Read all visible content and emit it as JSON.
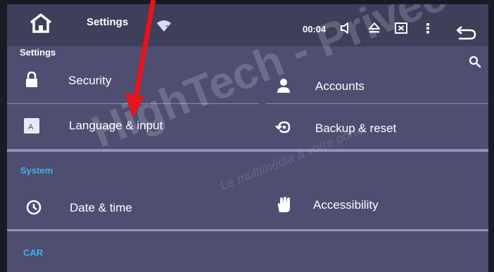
{
  "statusbar": {
    "title": "Settings",
    "time": "00:04",
    "icons": [
      "home-icon",
      "wifi-icon",
      "volume-icon",
      "eject-icon",
      "close-box-icon",
      "more-vert-icon",
      "back-icon"
    ]
  },
  "header": {
    "label": "Settings",
    "search_icon": "search-icon"
  },
  "personal": {
    "items": [
      {
        "label": "Security",
        "icon": "lock-icon"
      },
      {
        "label": "Accounts",
        "icon": "person-icon"
      },
      {
        "label": "Language & input",
        "icon": "keyboard-a-icon"
      },
      {
        "label": "Backup & reset",
        "icon": "backup-icon"
      }
    ]
  },
  "system": {
    "title": "System",
    "items": [
      {
        "label": "Date & time",
        "icon": "clock-icon"
      },
      {
        "label": "Accessibility",
        "icon": "hand-icon"
      }
    ]
  },
  "car": {
    "title": "CAR"
  },
  "watermark": {
    "text": "HighTech - Privee",
    "subtext": "Le multimédia à votre porte"
  },
  "colors": {
    "background": "#4d4e70",
    "statusbar": "#3e3f5b",
    "section_title": "#3fb1e8",
    "annotation_arrow": "#e8141b"
  }
}
